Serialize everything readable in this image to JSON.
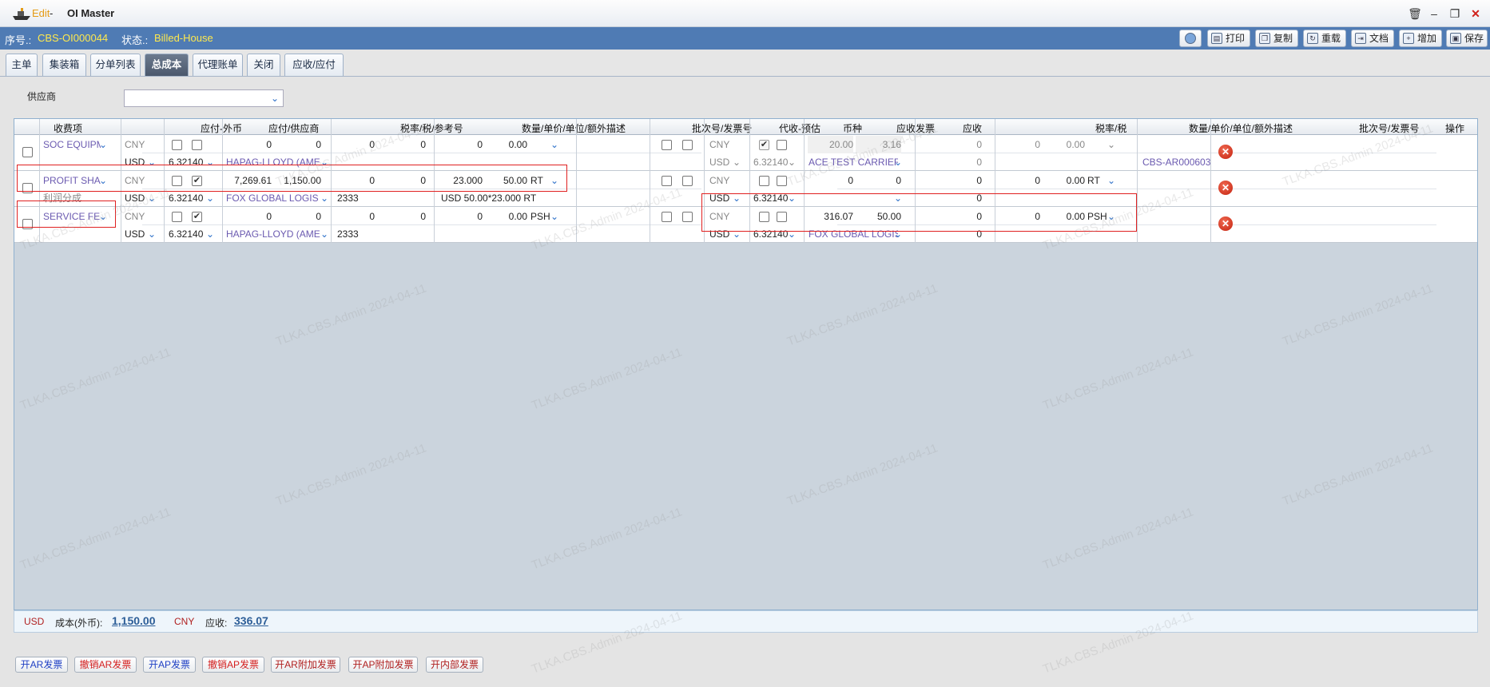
{
  "window": {
    "mode": "Edit",
    "sep": "-",
    "title": "OI Master"
  },
  "info": {
    "seq_label": "序号.:",
    "seq_value": "CBS-OI000044",
    "status_label": "状态.:",
    "status_value": "Billed-House"
  },
  "toolbar": {
    "print": "打印",
    "copy": "复制",
    "reload": "重载",
    "docs": "文档",
    "add": "增加",
    "save": "保存"
  },
  "tabs": [
    "主单",
    "集装箱",
    "分单列表",
    "总成本",
    "代理账单",
    "关闭",
    "应收/应付"
  ],
  "supplier_label": "供应商",
  "headers": [
    "收费项",
    "应付-外币",
    "应付/供应商",
    "税率/税/参考号",
    "数量/单价/单位/额外描述",
    "批次号/发票号",
    "代收-预估",
    "币种",
    "应收发票",
    "应收",
    "税率/税",
    "数量/单价/单位/额外描述",
    "批次号/发票号",
    "操作"
  ],
  "rows": [
    {
      "charge": "SOC EQUIPM",
      "ap_cur1": "CNY",
      "ap_cur2": "USD",
      "ap_rate": "6.32140",
      "ap_amt": "0",
      "ap_foreign": "0",
      "ap_vendor": "HAPAG-LLOYD (AME",
      "tax_rate": "0",
      "tax": "0",
      "ref": "",
      "qty": "0",
      "price": "0.00",
      "unit": "",
      "desc": "",
      "ar_cur1": "CNY",
      "ar_cur2": "USD",
      "ar_rate": "6.32140",
      "ar_amt": "20.00",
      "ar_foreign": "3.16",
      "ar_customer": "ACE TEST CARRIER",
      "ar_tax": "0",
      "ar_tax2": "0",
      "ar_qty": "0",
      "ar_price": "0.00",
      "ar_unit": "",
      "ar_batch": "CBS-AR000603",
      "sub": ""
    },
    {
      "charge": "PROFIT SHAI",
      "ap_cur1": "CNY",
      "ap_cur2": "USD",
      "ap_rate": "6.32140",
      "ap_amt": "7,269.61",
      "ap_foreign": "1,150.00",
      "ap_vendor": "FOX GLOBAL LOGIS",
      "tax_rate": "0",
      "tax": "0",
      "ref": "2333",
      "qty": "23.000",
      "price": "50.00",
      "unit": "RT",
      "desc": "USD 50.00*23.000 RT",
      "ar_cur1": "CNY",
      "ar_cur2": "USD",
      "ar_rate": "6.32140",
      "ar_amt": "0",
      "ar_foreign": "0",
      "ar_customer": "",
      "ar_tax": "0",
      "ar_tax2": "0",
      "ar_qty": "0",
      "ar_price": "0.00",
      "ar_unit": "RT",
      "ar_batch": "",
      "sub": "利润分成"
    },
    {
      "charge": "SERVICE FEI",
      "ap_cur1": "CNY",
      "ap_cur2": "USD",
      "ap_rate": "6.32140",
      "ap_amt": "0",
      "ap_foreign": "0",
      "ap_vendor": "HAPAG-LLOYD (AME",
      "tax_rate": "0",
      "tax": "0",
      "ref": "2333",
      "qty": "0",
      "price": "0.00",
      "unit": "PSH",
      "desc": "",
      "ar_cur1": "CNY",
      "ar_cur2": "USD",
      "ar_rate": "6.32140",
      "ar_amt": "316.07",
      "ar_foreign": "50.00",
      "ar_customer": "FOX GLOBAL LOGIS",
      "ar_tax": "0",
      "ar_tax2": "0",
      "ar_qty": "0",
      "ar_price": "0.00",
      "ar_unit": "PSH",
      "ar_batch": "",
      "sub": ""
    }
  ],
  "footer": {
    "cur1": "USD",
    "cost_label": "成本(外币):",
    "cost_value": "1,150.00",
    "cur2": "CNY",
    "ar_label": "应收:",
    "ar_value": "336.07"
  },
  "buttons": [
    "开AR发票",
    "撤销AR发票",
    "开AP发票",
    "撤销AP发票",
    "开AR附加发票",
    "开AP附加发票",
    "开内部发票"
  ],
  "watermark": "TLKA.CBS.Admin 2024-04-11",
  "colors": {
    "infobar": "#4f7bb4",
    "highlight": "#ffe94d",
    "accent": "#2b6fc8",
    "danger": "#e02020"
  }
}
